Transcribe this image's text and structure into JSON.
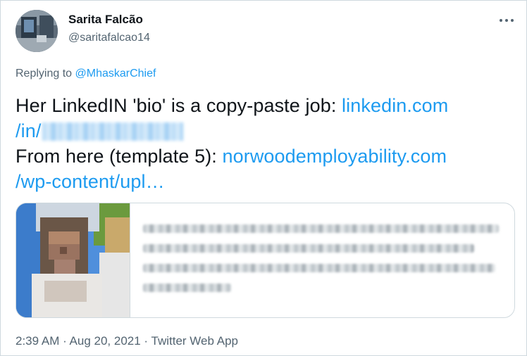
{
  "author": {
    "display_name": "Sarita Falcão",
    "handle": "@saritafalcao14"
  },
  "reply": {
    "prefix": "Replying to",
    "target": "@MhaskarChief"
  },
  "tweet": {
    "line1_text": "Her LinkedIN 'bio' is a copy-paste job: ",
    "link1_a": "linkedin.com",
    "link1_b": "/in/",
    "line3_text": "From here (template 5): ",
    "link2_a": "norwoodemployability.com",
    "link2_b": "/wp-content/upl…"
  },
  "meta": {
    "time": "2:39 AM",
    "separator": " · ",
    "date": "Aug 20, 2021",
    "source": "Twitter Web App"
  },
  "colors": {
    "link": "#1d9bf0",
    "muted": "#536471",
    "text": "#0f1419",
    "border": "#cfd9de"
  },
  "icons": {
    "more": "more-horizontal-icon"
  }
}
